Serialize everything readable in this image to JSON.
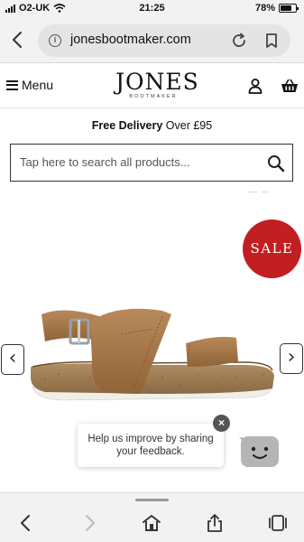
{
  "status_bar": {
    "carrier": "O2-UK",
    "time": "21:25",
    "battery": "78%",
    "battery_level": 0.78
  },
  "browser": {
    "url": "jonesbootmaker.com",
    "icons": [
      "back-chevron-icon",
      "info-icon",
      "reload-icon",
      "bookmark-icon"
    ]
  },
  "header": {
    "menu_label": "Menu",
    "logo_text": "JONES",
    "logo_subtext": "BOOTMAKER",
    "icons": [
      "hamburger-icon",
      "account-icon",
      "basket-icon"
    ]
  },
  "promo": {
    "delivery_bold": "Free Delivery",
    "delivery_rest": " Over £95"
  },
  "search": {
    "placeholder": "Tap here to search all products..."
  },
  "product": {
    "badge": "SALE",
    "prev_arrow": "‹",
    "next_arrow": "›"
  },
  "feedback": {
    "line1": "Help us improve by sharing",
    "line2": "your feedback.",
    "close": "×"
  },
  "toolbar": {
    "icons": [
      "back-arrow-icon",
      "forward-arrow-icon",
      "home-icon",
      "share-icon",
      "tabs-icon"
    ]
  },
  "colors": {
    "sale_red": "#c21f22",
    "browser_gray": "#f2f2f2",
    "sandal_tan": "#a97a4a",
    "cork": "#a3845e"
  }
}
